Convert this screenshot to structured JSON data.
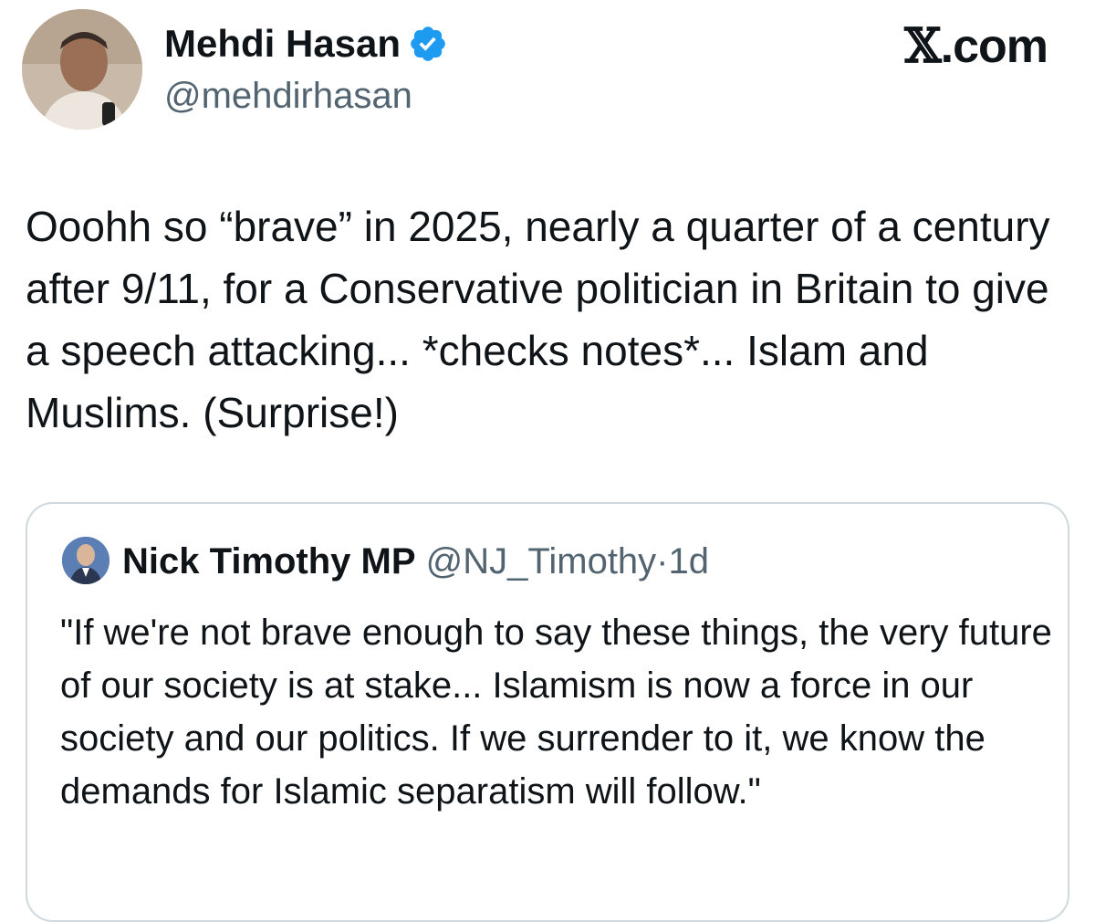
{
  "tweet": {
    "author_name": "Mehdi Hasan",
    "author_handle": "@mehdirhasan",
    "verified": true,
    "text": "Ooohh so “brave” in 2025, nearly a quarter of a century after 9/11, for a Conservative politician in Britain to give a speech attacking... *checks notes*... Islam and Muslims. (Surprise!)"
  },
  "brand": {
    "x_glyph": "𝕏",
    "suffix": ".com"
  },
  "quoted_tweet": {
    "author_name": "Nick Timothy MP",
    "author_handle": "@NJ_Timothy",
    "separator": "·",
    "timestamp": "1d",
    "text": "\"If we're not brave enough to say these things, the very future of our society is at stake... Islamism is now a force in our society and our politics. If we surrender to it, we know the demands for Islamic separatism will follow.\""
  },
  "colors": {
    "text": "#0f1419",
    "secondary_text": "#536471",
    "verified_badge": "#1d9bf0",
    "quote_border": "#cfd9de"
  },
  "icons": {
    "verified": "verified-badge-icon",
    "avatar": "profile-photo",
    "quoted_avatar": "profile-photo"
  }
}
